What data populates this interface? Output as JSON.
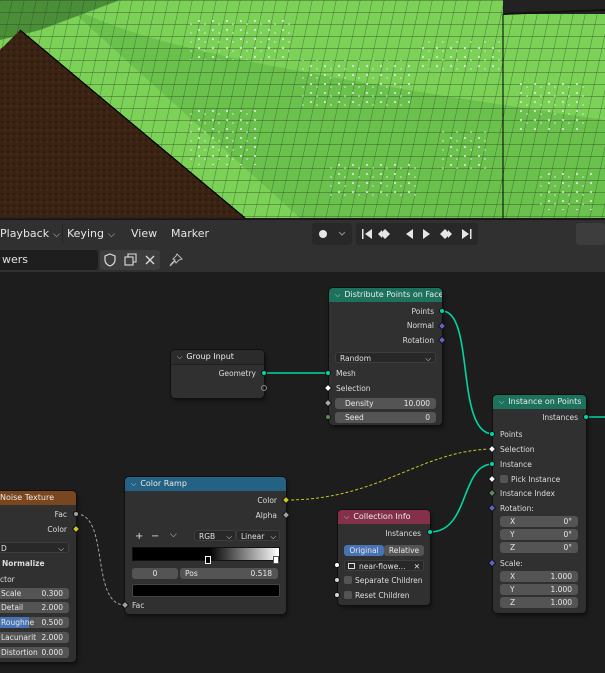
{
  "timeline": {
    "playback": "Playback",
    "keying": "Keying",
    "view": "View",
    "marker": "Marker"
  },
  "node_header": {
    "tree_name": "wers"
  },
  "nodes": {
    "distribute": {
      "title": "Distribute Points on Faces",
      "out_points": "Points",
      "out_normal": "Normal",
      "out_rotation": "Rotation",
      "mode": "Random",
      "in_mesh": "Mesh",
      "in_selection": "Selection",
      "density_label": "Density",
      "density_value": "10.000",
      "seed_label": "Seed",
      "seed_value": "0"
    },
    "group_input": {
      "title": "Group Input",
      "out_geometry": "Geometry"
    },
    "instance": {
      "title": "Instance on Points",
      "out_instances": "Instances",
      "in_points": "Points",
      "in_selection": "Selection",
      "in_instance": "Instance",
      "pick_instance": "Pick Instance",
      "instance_index": "Instance Index",
      "rotation_label": "Rotation:",
      "rot_x_label": "X",
      "rot_x": "0°",
      "rot_y_label": "Y",
      "rot_y": "0°",
      "rot_z_label": "Z",
      "rot_z": "0°",
      "scale_label": "Scale:",
      "sc_x_label": "X",
      "sc_x": "1.000",
      "sc_y_label": "Y",
      "sc_y": "1.000",
      "sc_z_label": "Z",
      "sc_z": "1.000"
    },
    "noise": {
      "title": "Noise Texture",
      "out_fac": "Fac",
      "out_color": "Color",
      "dim": "D",
      "normalize": "Normalize",
      "vector": "ctor",
      "rows": [
        {
          "label": "Scale",
          "value": "0.300"
        },
        {
          "label": "Detail",
          "value": "2.000"
        },
        {
          "label": "Roughne",
          "value": "0.500"
        },
        {
          "label": "Lacunarit",
          "value": "2.000"
        },
        {
          "label": "Distortion",
          "value": "0.000"
        }
      ]
    },
    "ramp": {
      "title": "Color Ramp",
      "out_color": "Color",
      "out_alpha": "Alpha",
      "plus": "+",
      "minus": "−",
      "color_mode": "RGB",
      "interp": "Linear",
      "index": "0",
      "pos_label": "Pos",
      "pos_value": "0.518",
      "in_fac": "Fac"
    },
    "collection": {
      "title": "Collection Info",
      "out_instances": "Instances",
      "btn_original": "Original",
      "btn_relative": "Relative",
      "collection_name": "near-flowe...",
      "separate_children": "Separate Children",
      "reset_children": "Reset Children"
    }
  },
  "colors": {
    "geometry_header": "#1d725e",
    "texture_header": "#79461d",
    "converter_header": "#246283",
    "input_header": "#83314a",
    "geometry_socket": "#00d6a3",
    "color_socket": "#c7c729",
    "accent_blue": "#4772b3"
  }
}
